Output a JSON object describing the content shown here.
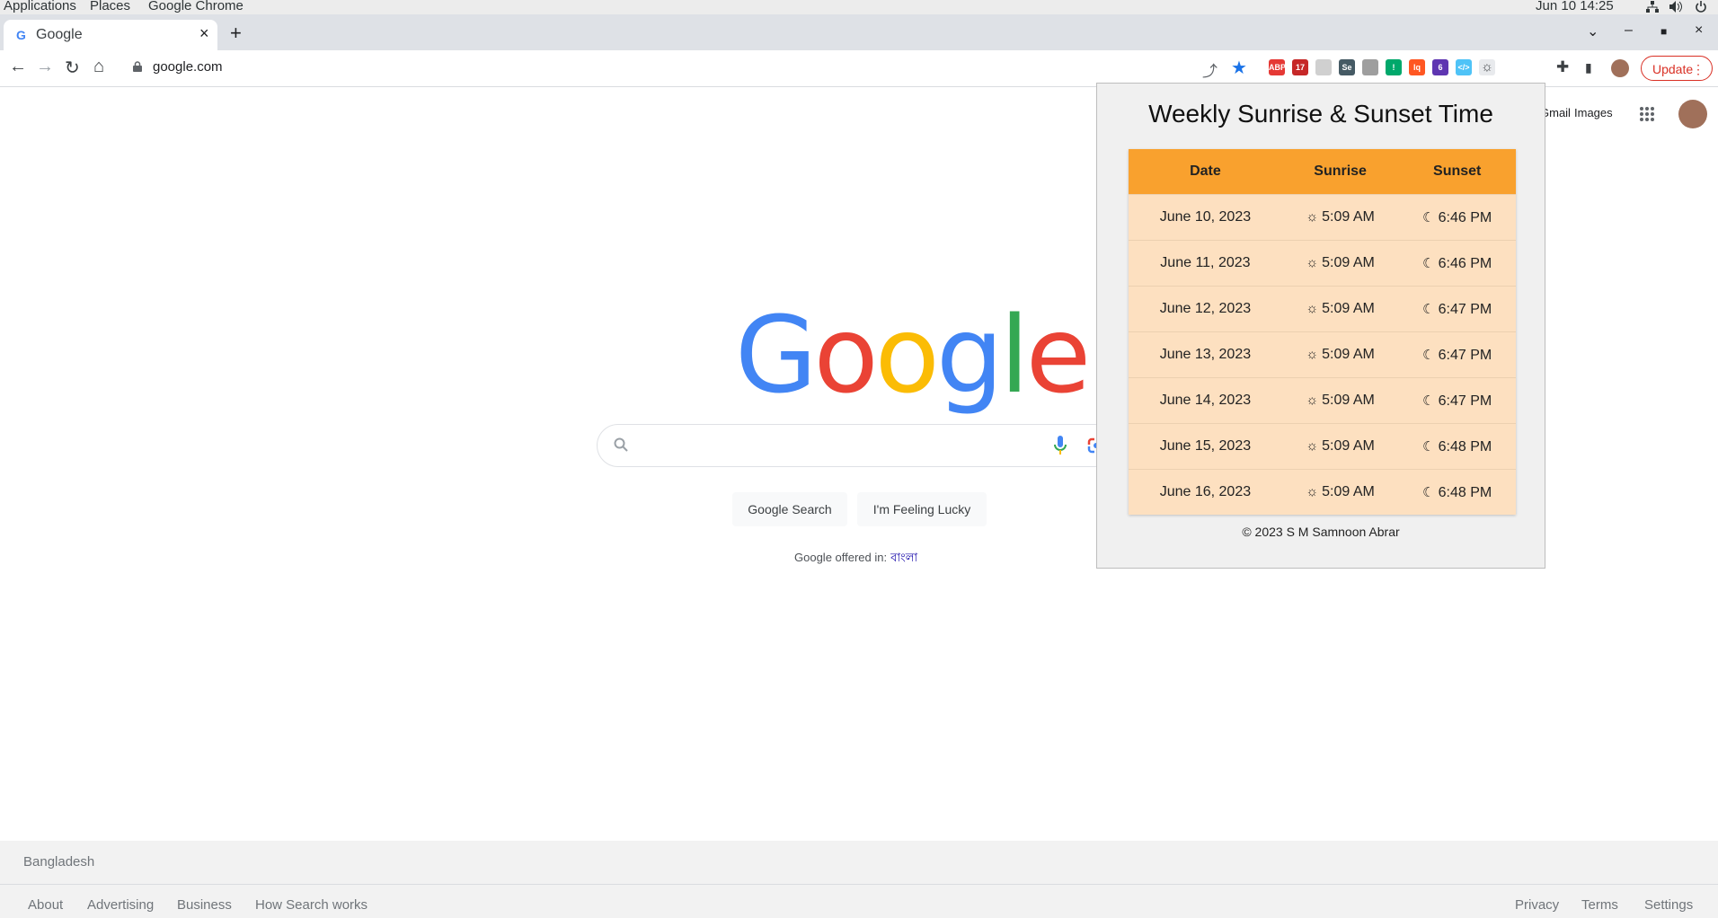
{
  "topbar": {
    "applications": "Applications",
    "places": "Places",
    "app_name": "Google Chrome",
    "clock": "Jun 10  14:25"
  },
  "browser": {
    "tab_title": "Google",
    "url": "google.com",
    "update_label": "Update",
    "extensions": [
      {
        "name": "adblock-plus",
        "label": "ABP",
        "color": "#e53935"
      },
      {
        "name": "calendar",
        "label": "17",
        "color": "#c62828"
      },
      {
        "name": "blank-ext",
        "label": "",
        "color": "#d0d0d0"
      },
      {
        "name": "selenium-ide",
        "label": "Se",
        "color": "#455a64"
      },
      {
        "name": "grey-ext",
        "label": "",
        "color": "#9e9e9e"
      },
      {
        "name": "green-ext",
        "label": "!",
        "color": "#00a86b"
      },
      {
        "name": "red-ext",
        "label": "lq",
        "color": "#ff5722"
      },
      {
        "name": "purple-ext",
        "label": "6",
        "color": "#5e35b1"
      },
      {
        "name": "code-ext",
        "label": "</>",
        "color": "#4fc3f7"
      },
      {
        "name": "sun-ext",
        "label": "☼",
        "color": "#e8eaed"
      }
    ]
  },
  "google": {
    "header_links": [
      "Gmail",
      "Images"
    ],
    "logo_letters": [
      "G",
      "o",
      "o",
      "g",
      "l",
      "e"
    ],
    "logo_colors": [
      "#4285F4",
      "#EA4335",
      "#FBBC05",
      "#4285F4",
      "#34A853",
      "#EA4335"
    ],
    "search_button": "Google Search",
    "lucky_button": "I'm Feeling Lucky",
    "offered_in": "Google offered in:",
    "language": "বাংলা",
    "country": "Bangladesh",
    "footer_left": [
      "About",
      "Advertising",
      "Business",
      "How Search works"
    ],
    "footer_right": [
      "Privacy",
      "Terms",
      "Settings"
    ]
  },
  "popup": {
    "title": "Weekly Sunrise & Sunset Time",
    "headers": [
      "Date",
      "Sunrise",
      "Sunset"
    ],
    "rows": [
      {
        "date": "June 10, 2023",
        "sunrise": "5:09 AM",
        "sunset": "6:46 PM"
      },
      {
        "date": "June 11, 2023",
        "sunrise": "5:09 AM",
        "sunset": "6:46 PM"
      },
      {
        "date": "June 12, 2023",
        "sunrise": "5:09 AM",
        "sunset": "6:47 PM"
      },
      {
        "date": "June 13, 2023",
        "sunrise": "5:09 AM",
        "sunset": "6:47 PM"
      },
      {
        "date": "June 14, 2023",
        "sunrise": "5:09 AM",
        "sunset": "6:47 PM"
      },
      {
        "date": "June 15, 2023",
        "sunrise": "5:09 AM",
        "sunset": "6:48 PM"
      },
      {
        "date": "June 16, 2023",
        "sunrise": "5:09 AM",
        "sunset": "6:48 PM"
      }
    ],
    "footer": "© 2023 S M Samnoon Abrar"
  }
}
